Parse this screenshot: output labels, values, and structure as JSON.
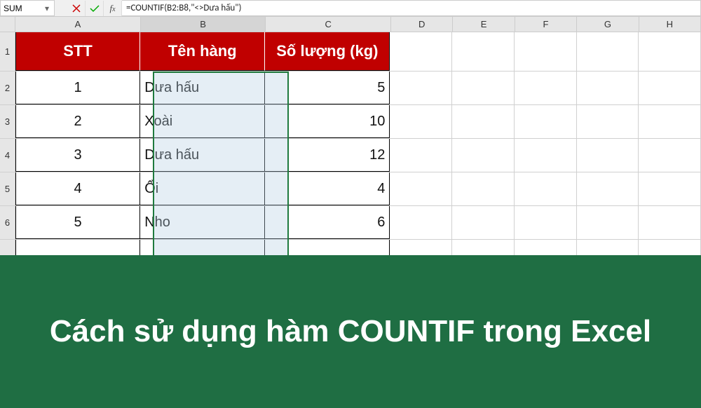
{
  "formula_bar": {
    "name_box": "SUM",
    "formula": "=COUNTIF(B2:B8,\"<>Dưa hấu\")"
  },
  "columns": [
    {
      "label": "A",
      "width": 194
    },
    {
      "label": "B",
      "width": 194
    },
    {
      "label": "C",
      "width": 194
    },
    {
      "label": "D",
      "width": 96
    },
    {
      "label": "E",
      "width": 96
    },
    {
      "label": "F",
      "width": 96
    },
    {
      "label": "G",
      "width": 96
    },
    {
      "label": "H",
      "width": 96
    }
  ],
  "headers": {
    "A": "STT",
    "B": "Tên hàng",
    "C": "Số lượng (kg)"
  },
  "rows": [
    {
      "n": 2,
      "A": "1",
      "B": "Dưa hấu",
      "C": "5"
    },
    {
      "n": 3,
      "A": "2",
      "B": "Xoài",
      "C": "10"
    },
    {
      "n": 4,
      "A": "3",
      "B": "Dưa hấu",
      "C": "12"
    },
    {
      "n": 5,
      "A": "4",
      "B": "Ổi",
      "C": "4"
    },
    {
      "n": 6,
      "A": "5",
      "B": "Nho",
      "C": "6"
    }
  ],
  "banner": "Cách sử dụng hàm COUNTIF trong Excel"
}
